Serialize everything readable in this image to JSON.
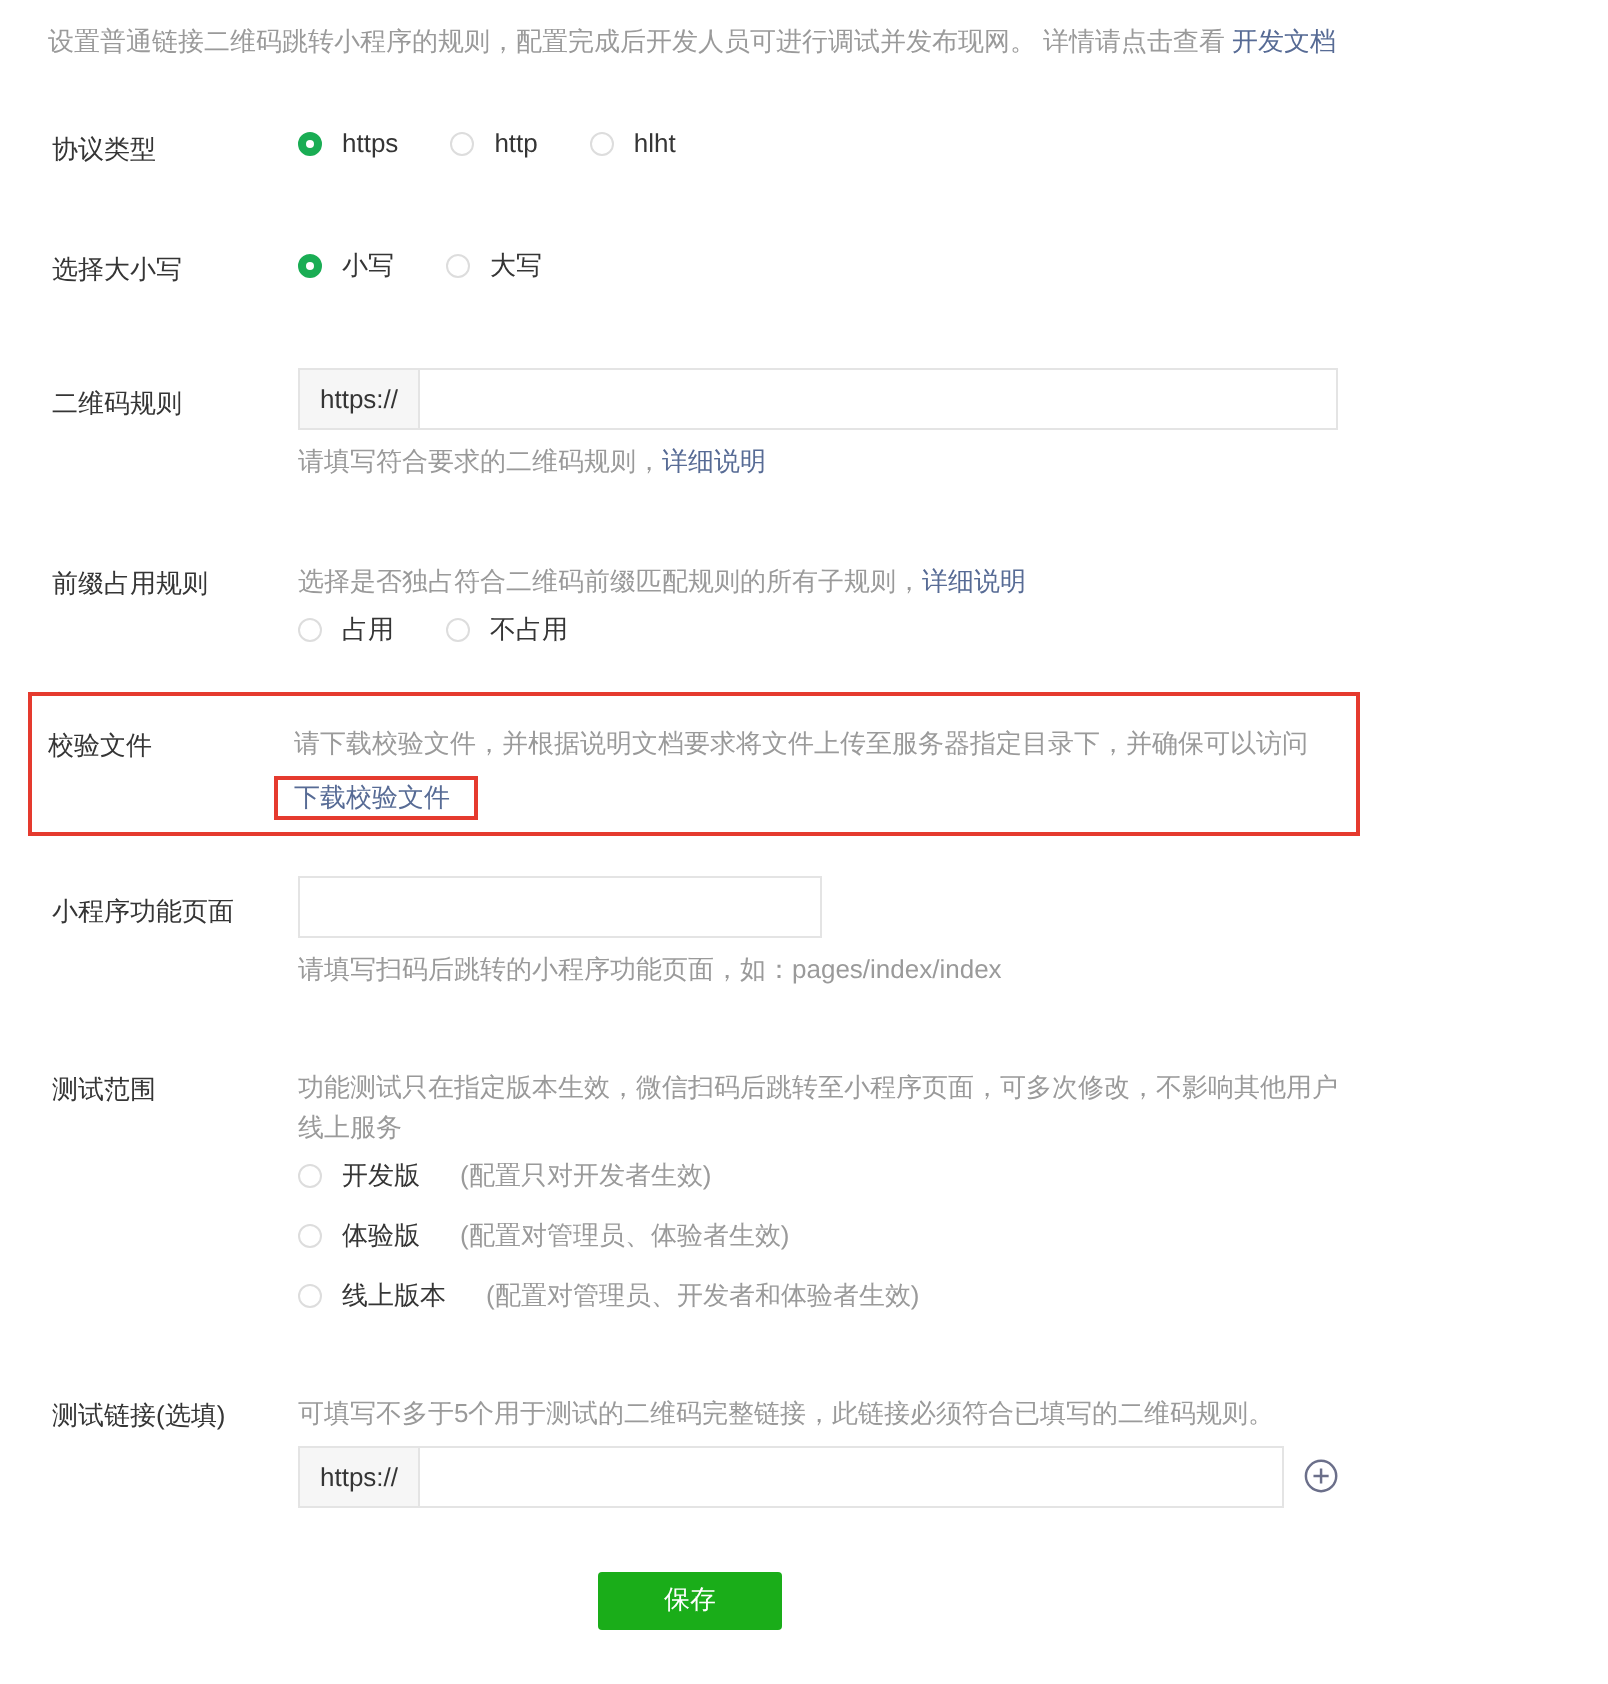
{
  "intro": {
    "text": "设置普通链接二维码跳转小程序的规则，配置完成后开发人员可进行调试并发布现网。 详情请点击查看",
    "link": "开发文档"
  },
  "fields": [
    {
      "label": "协议类型",
      "highlighted": false,
      "parts": [
        {
          "kind": "radios",
          "options": [
            {
              "label": "https",
              "selected": true
            },
            {
              "label": "http",
              "selected": false
            },
            {
              "label": "hlht",
              "selected": false
            }
          ]
        }
      ]
    },
    {
      "label": "选择大小写",
      "highlighted": false,
      "parts": [
        {
          "kind": "radios",
          "options": [
            {
              "label": "小写",
              "selected": true
            },
            {
              "label": "大写",
              "selected": false
            }
          ]
        }
      ]
    },
    {
      "label": "二维码规则",
      "highlighted": false,
      "parts": [
        {
          "kind": "input",
          "prefix": "https://",
          "add": false
        },
        {
          "kind": "hint",
          "text": "请填写符合要求的二维码规则，",
          "link": "详细说明"
        }
      ]
    },
    {
      "label": "前缀占用规则",
      "highlighted": false,
      "parts": [
        {
          "kind": "hint",
          "text": "选择是否独占符合二维码前缀匹配规则的所有子规则，",
          "link": "详细说明"
        },
        {
          "kind": "radios",
          "options": [
            {
              "label": "占用",
              "selected": false
            },
            {
              "label": "不占用",
              "selected": false
            }
          ]
        }
      ]
    },
    {
      "label": "校验文件",
      "highlighted": true,
      "parts": [
        {
          "kind": "hint",
          "text": "请下载校验文件，并根据说明文档要求将文件上传至服务器指定目录下，并确保可以访问"
        },
        {
          "kind": "link",
          "text": "下载校验文件",
          "highlighted": true
        }
      ]
    },
    {
      "label": "小程序功能页面",
      "highlighted": false,
      "parts": [
        {
          "kind": "input",
          "add": false
        },
        {
          "kind": "hint",
          "text": "请填写扫码后跳转的小程序功能页面，如：pages/index/index"
        }
      ]
    },
    {
      "label": "测试范围",
      "highlighted": false,
      "parts": [
        {
          "kind": "hint",
          "text": "功能测试只在指定版本生效，微信扫码后跳转至小程序页面，可多次修改，不影响其他用户线上服务"
        },
        {
          "kind": "radio_list",
          "options": [
            {
              "label": "开发版",
              "note": "(配置只对开发者生效)",
              "selected": false
            },
            {
              "label": "体验版",
              "note": "(配置对管理员、体验者生效)",
              "selected": false
            },
            {
              "label": "线上版本",
              "note": "(配置对管理员、开发者和体验者生效)",
              "selected": false
            }
          ]
        }
      ]
    },
    {
      "label": "测试链接(选填)",
      "highlighted": false,
      "parts": [
        {
          "kind": "hint",
          "text": "可填写不多于5个用于测试的二维码完整链接，此链接必须符合已填写的二维码规则。"
        },
        {
          "kind": "input",
          "prefix": "https://",
          "add": true
        }
      ]
    }
  ],
  "save_button": "保存"
}
